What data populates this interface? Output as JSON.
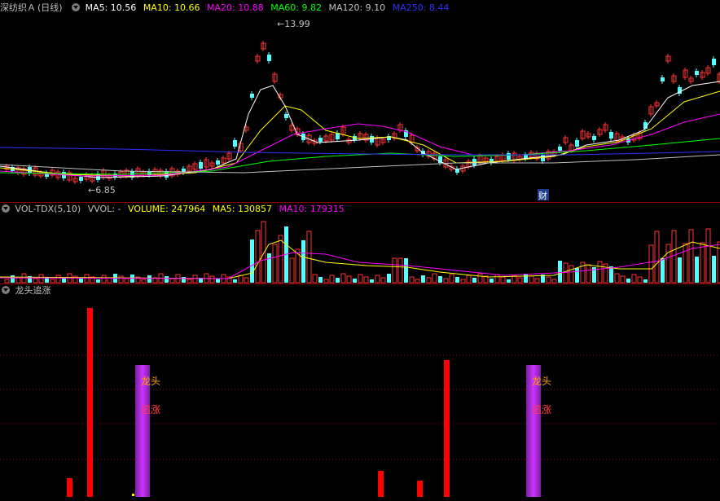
{
  "price_panel": {
    "title": "深纺织Ａ",
    "period": "(日线)",
    "ma": [
      {
        "label": "MA5: 10.56",
        "color": "#ffffff"
      },
      {
        "label": "MA10: 10.66",
        "color": "#ffff00"
      },
      {
        "label": "MA20: 10.88",
        "color": "#ff00ff"
      },
      {
        "label": "MA60: 9.82",
        "color": "#00ff00"
      },
      {
        "label": "MA120: 9.10",
        "color": "#c0c0c0"
      },
      {
        "label": "MA250: 8.44",
        "color": "#3030ff"
      }
    ],
    "high_marker": "13.99",
    "low_marker": "6.85",
    "cai_badge": "财"
  },
  "volume_panel": {
    "title": "VOL-TDX(5,10)",
    "vvol": "VVOL: -",
    "volume": "VOLUME: 247964",
    "ma5": "MA5: 130857",
    "ma10": "MA10: 179315"
  },
  "indicator_panel": {
    "title": "龙头追涨",
    "label_top": "龙头",
    "label_bottom": "追涨"
  },
  "colors": {
    "up": "#ff3232",
    "down": "#54ffff",
    "ma5": "#ffffff",
    "ma10": "#ffff00",
    "ma20": "#ff00ff",
    "ma60": "#00ff00",
    "ma120": "#c0c0c0",
    "ma250": "#3030ff",
    "grid": "#8b0000",
    "indicator_bar": "#ff0000",
    "indicator_band": "#cc33ff"
  }
}
